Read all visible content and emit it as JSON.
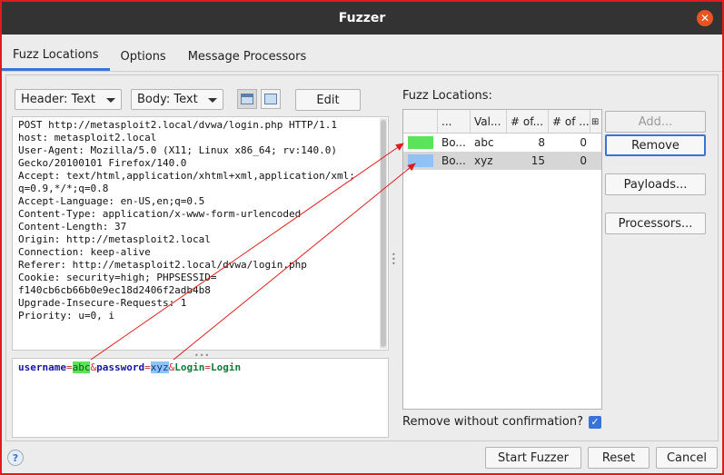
{
  "window": {
    "title": "Fuzzer",
    "close_glyph": "✕"
  },
  "tabs": [
    {
      "label": "Fuzz Locations",
      "active": true
    },
    {
      "label": "Options",
      "active": false
    },
    {
      "label": "Message Processors",
      "active": false
    }
  ],
  "toolbar": {
    "header_select": "Header: Text",
    "body_select": "Body: Text",
    "edit_label": "Edit"
  },
  "request": {
    "header_lines": [
      "POST http://metasploit2.local/dvwa/login.php HTTP/1.1",
      "host: metasploit2.local",
      "User-Agent: Mozilla/5.0 (X11; Linux x86_64; rv:140.0)",
      "Gecko/20100101 Firefox/140.0",
      "Accept: text/html,application/xhtml+xml,application/xml;",
      "q=0.9,*/*;q=0.8",
      "Accept-Language: en-US,en;q=0.5",
      "Content-Type: application/x-www-form-urlencoded",
      "Content-Length: 37",
      "Origin: http://metasploit2.local",
      "Connection: keep-alive",
      "Referer: http://metasploit2.local/dvwa/login.php",
      "Cookie: security=high; PHPSESSID=",
      "f140cb6cb66b0e9ec18d2406f2adb4b8",
      "Upgrade-Insecure-Requests: 1",
      "Priority: u=0, i"
    ],
    "body": {
      "k1": "username",
      "eq1": "=",
      "v1": "abc",
      "amp1": "&",
      "k2": "password",
      "eq2": "=",
      "v2": "xyz",
      "amp2": "&",
      "k3": "Login",
      "eq3": "=",
      "v3": "Login"
    }
  },
  "fuzz_locations": {
    "label": "Fuzz Locations:",
    "columns": [
      "...",
      "Val...",
      "# of...",
      "# of ..."
    ],
    "rows": [
      {
        "color": "#5be35b",
        "location": "Bo...",
        "value": "abc",
        "count1": "8",
        "count2": "0",
        "selected": false
      },
      {
        "color": "#8fc3f7",
        "location": "Bo...",
        "value": "xyz",
        "count1": "15",
        "count2": "0",
        "selected": true
      }
    ]
  },
  "side_buttons": {
    "add": "Add...",
    "remove": "Remove",
    "payloads": "Payloads...",
    "processors": "Processors..."
  },
  "confirm": {
    "label": "Remove without confirmation?",
    "checked": true,
    "check_glyph": "✓"
  },
  "footer": {
    "help_glyph": "?",
    "start": "Start Fuzzer",
    "reset": "Reset",
    "cancel": "Cancel"
  },
  "colors": {
    "accent": "#3874d8",
    "annotation_red": "#e01b1b",
    "close_orange": "#e95420"
  }
}
